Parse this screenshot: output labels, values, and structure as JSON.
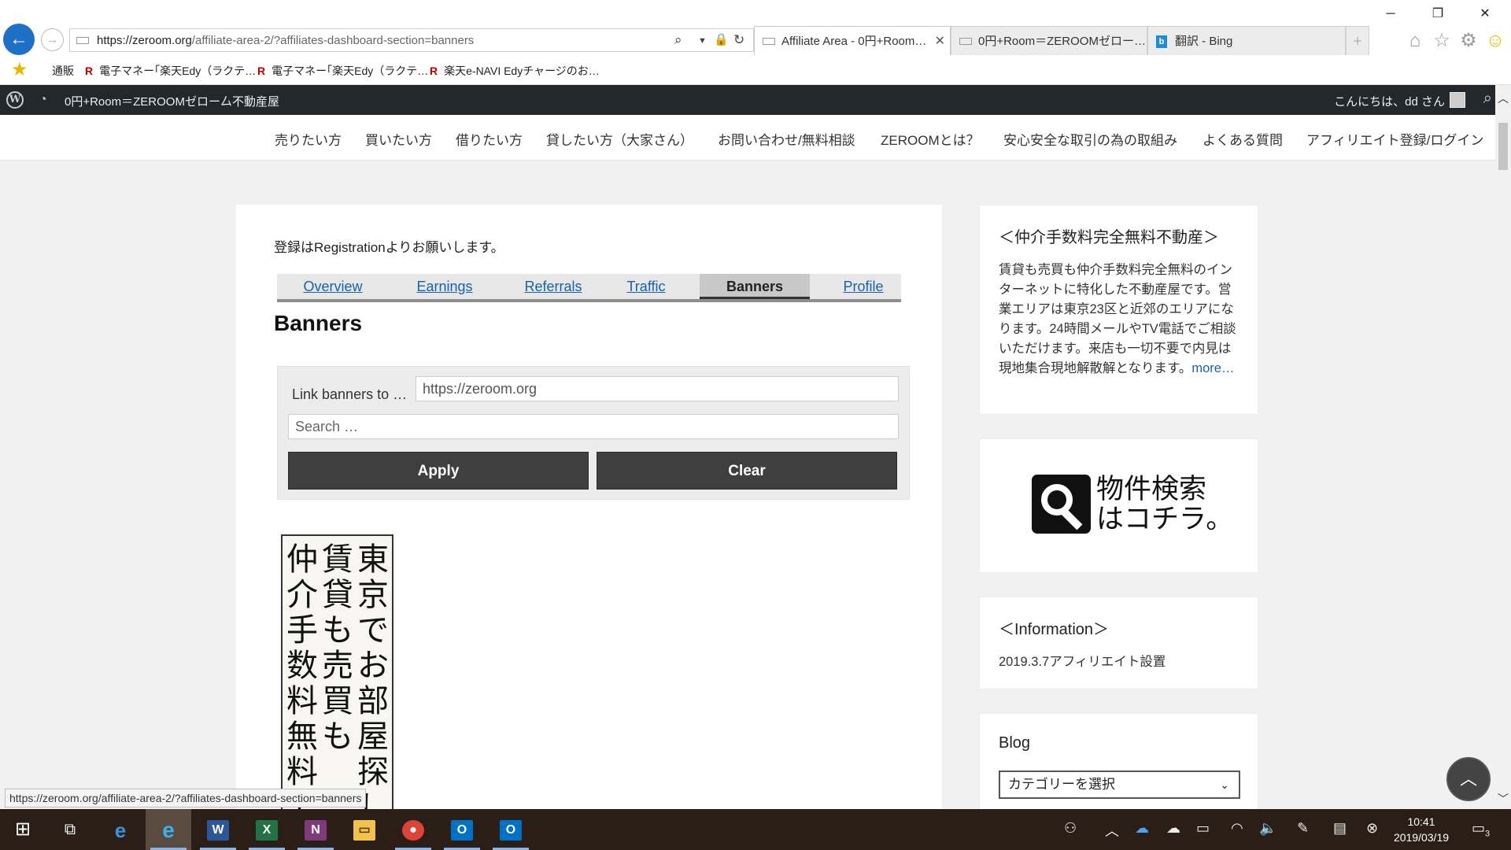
{
  "browser": {
    "address_url": "https://zeroom.org",
    "address_url_rest": "/affiliate-area-2/?affiliates-dashboard-section=banners",
    "tabs": [
      {
        "label": "Affiliate Area - 0円+Room…"
      },
      {
        "label": "0円+Room＝ZEROOMゼロー…"
      },
      {
        "label": "翻訳 - Bing"
      }
    ],
    "favorites": [
      {
        "label": "通販"
      },
      {
        "label": "電子マネー｢楽天Edy（ラクテ…"
      },
      {
        "label": "電子マネー｢楽天Edy（ラクテ…"
      },
      {
        "label": "楽天e-NAVI Edyチャージのお…"
      }
    ],
    "status_url": "https://zeroom.org/affiliate-area-2/?affiliates-dashboard-section=banners"
  },
  "adminbar": {
    "site_name": "0円+Room＝ZEROOMゼロー厶不動産屋",
    "greeting": "こんにちは、dd さん"
  },
  "nav": {
    "items": [
      {
        "label": "売りたい方"
      },
      {
        "label": "買いたい方"
      },
      {
        "label": "借りたい方"
      },
      {
        "label": "貸したい方（大家さん）"
      },
      {
        "label": "お問い合わせ/無料相談"
      },
      {
        "label": "ZEROOMとは？"
      },
      {
        "label": "安心安全な取引の為の取組み"
      },
      {
        "label": "よくある質問"
      },
      {
        "label": "アフィリエイト登録/ログイン"
      }
    ]
  },
  "main": {
    "intro": "登録はRegistrationよりお願いします。",
    "tabs": [
      {
        "label": "Overview"
      },
      {
        "label": "Earnings"
      },
      {
        "label": "Referrals"
      },
      {
        "label": "Traffic"
      },
      {
        "label": "Banners"
      },
      {
        "label": "Profile"
      }
    ],
    "active_tab": "Banners",
    "heading": "Banners",
    "form": {
      "link_label": "Link banners to …",
      "link_value": "https://zeroom.org",
      "search_placeholder": "Search …",
      "apply_label": "Apply",
      "clear_label": "Clear"
    },
    "banner": {
      "col1": "東京でお部屋探し",
      "col2": "賃貸も売買も",
      "col3": "仲介手数料無料で"
    }
  },
  "sidebar": {
    "about_title": "＜仲介手数料完全無料不動産＞",
    "about_text": "賃貸も売買も仲介手数料完全無料のインターネットに特化した不動産屋です。営業エリアは東京23区と近郊のエリアになります。24時間メールやTV電話でご相談いただけます。来店も一切不要で内見は現地集合現地解散解となります。",
    "about_more": "more…",
    "search_banner_line1": "物件検索",
    "search_banner_line2": "はコチラ。",
    "info_title": "＜Information＞",
    "info_text": "2019.3.7アフィリエイト設置",
    "blog_title": "Blog",
    "blog_select": "カテゴリーを選択"
  },
  "taskbar": {
    "time": "10:41",
    "date": "2019/03/19",
    "notifications": "3"
  }
}
